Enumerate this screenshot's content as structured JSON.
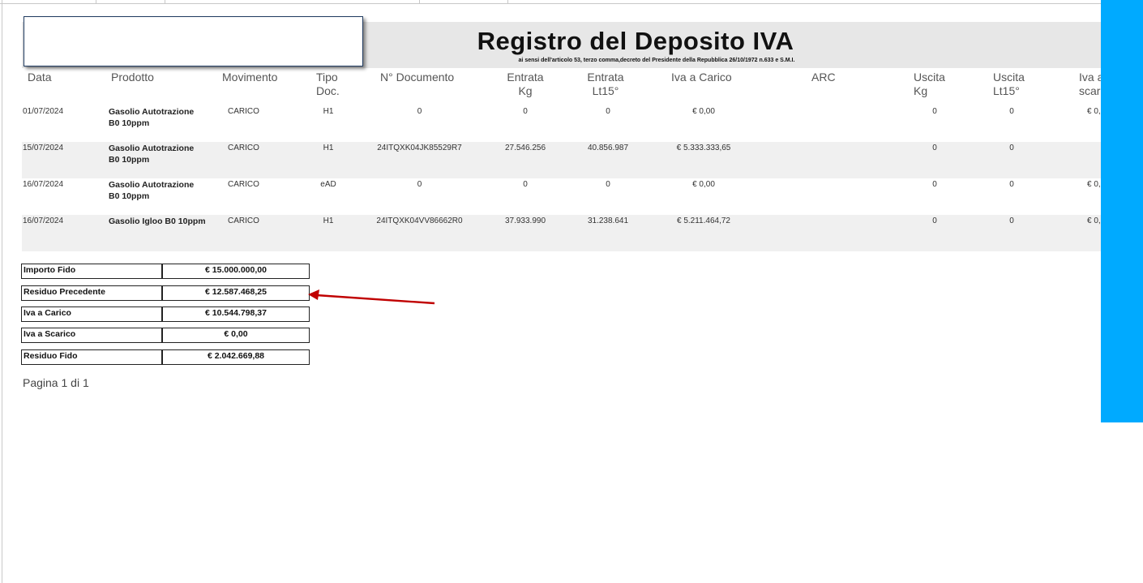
{
  "report": {
    "title": "Registro del Deposito IVA",
    "subtitle": "ai sensi dell'articolo 53, terzo comma,decreto del Presidente della Repubblica 26/10/1972 n.633 e S.M.I."
  },
  "columns": {
    "data": "Data",
    "prodotto": "Prodotto",
    "movimento": "Movimento",
    "tipo_doc_1": "Tipo",
    "tipo_doc_2": "Doc.",
    "n_documento": "N° Documento",
    "entrata_kg_1": "Entrata",
    "entrata_kg_2": "Kg",
    "entrata_lt_1": "Entrata",
    "entrata_lt_2": "Lt15°",
    "iva_carico": "Iva a Carico",
    "arc": "ARC",
    "uscita_kg_1": "Uscita",
    "uscita_kg_2": "Kg",
    "uscita_lt_1": "Uscita",
    "uscita_lt_2": "Lt15°",
    "iva_scarico_1": "Iva a",
    "iva_scarico_2": "scar"
  },
  "rows": [
    {
      "data": "01/07/2024",
      "prodotto_1": "Gasolio Autotrazione",
      "prodotto_2": "B0 10ppm",
      "movimento": "CARICO",
      "tipo_doc": "H1",
      "n_documento": "0",
      "entrata_kg": "0",
      "entrata_lt": "0",
      "iva_carico": "€ 0,00",
      "uscita_kg": "0",
      "uscita_lt": "0",
      "iva_scarico": "€ 0,"
    },
    {
      "data": "15/07/2024",
      "prodotto_1": "Gasolio Autotrazione",
      "prodotto_2": "B0 10ppm",
      "movimento": "CARICO",
      "tipo_doc": "H1",
      "n_documento": "24ITQXK04JK85529R7",
      "entrata_kg": "27.546.256",
      "entrata_lt": "40.856.987",
      "iva_carico": "€ 5.333.333,65",
      "uscita_kg": "0",
      "uscita_lt": "0",
      "iva_scarico": ""
    },
    {
      "data": "16/07/2024",
      "prodotto_1": "Gasolio Autotrazione",
      "prodotto_2": "B0 10ppm",
      "movimento": "CARICO",
      "tipo_doc": "eAD",
      "n_documento": "0",
      "entrata_kg": "0",
      "entrata_lt": "0",
      "iva_carico": "€ 0,00",
      "uscita_kg": "0",
      "uscita_lt": "0",
      "iva_scarico": "€ 0,"
    },
    {
      "data": "16/07/2024",
      "prodotto_1": "Gasolio Igloo B0 10ppm",
      "prodotto_2": "",
      "movimento": "CARICO",
      "tipo_doc": "H1",
      "n_documento": "24ITQXK04VV86662R0",
      "entrata_kg": "37.933.990",
      "entrata_lt": "31.238.641",
      "iva_carico": "€ 5.211.464,72",
      "uscita_kg": "0",
      "uscita_lt": "0",
      "iva_scarico": "€ 0,"
    }
  ],
  "summary": [
    {
      "label": "Importo Fido",
      "value": "€ 15.000.000,00"
    },
    {
      "label": "Residuo Precedente",
      "value": "€ 12.587.468,25"
    },
    {
      "label": "Iva a Carico",
      "value": "€ 10.544.798,37"
    },
    {
      "label": "Iva a Scarico",
      "value": "€ 0,00"
    },
    {
      "label": "Residuo Fido",
      "value": "€ 2.042.669,88"
    }
  ],
  "pager": "Pagina 1 di 1",
  "colors": {
    "accent_bar": "#00aaff",
    "arrow": "#c00000",
    "header_band": "#e7e7e7"
  }
}
